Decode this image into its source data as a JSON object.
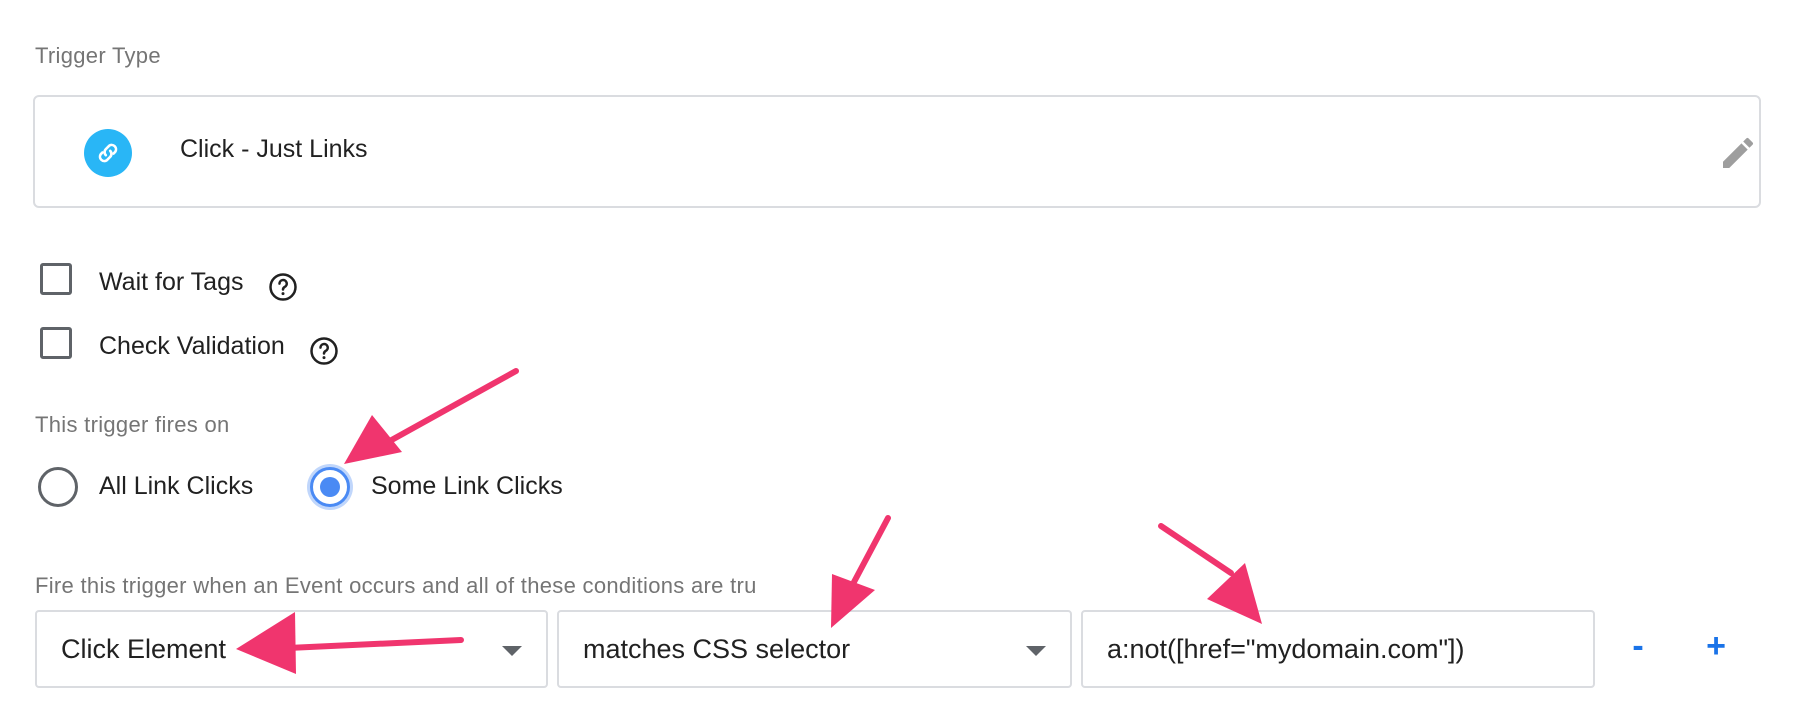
{
  "trigger_type": {
    "section_label": "Trigger Type",
    "name": "Click - Just Links",
    "badge_icon": "link-icon",
    "edit_icon": "pencil-icon"
  },
  "options": {
    "wait_for_tags": {
      "label": "Wait for Tags",
      "checked": false
    },
    "check_validation": {
      "label": "Check Validation",
      "checked": false
    }
  },
  "fires_on": {
    "section_label": "This trigger fires on",
    "all_link_clicks": "All Link Clicks",
    "some_link_clicks": "Some Link Clicks",
    "selected": "some_link_clicks"
  },
  "condition": {
    "section_label": "Fire this trigger when an Event occurs and all of these conditions are tru",
    "variable": "Click Element",
    "operator": "matches CSS selector",
    "value": "a:not([href=\"mydomain.com\"])",
    "remove_label": "-",
    "add_label": "+"
  },
  "colors": {
    "accent": "#4a8af4",
    "link_badge": "#29b6f6",
    "annotation_arrow": "#f0356e",
    "action_blue": "#1a73e8"
  }
}
